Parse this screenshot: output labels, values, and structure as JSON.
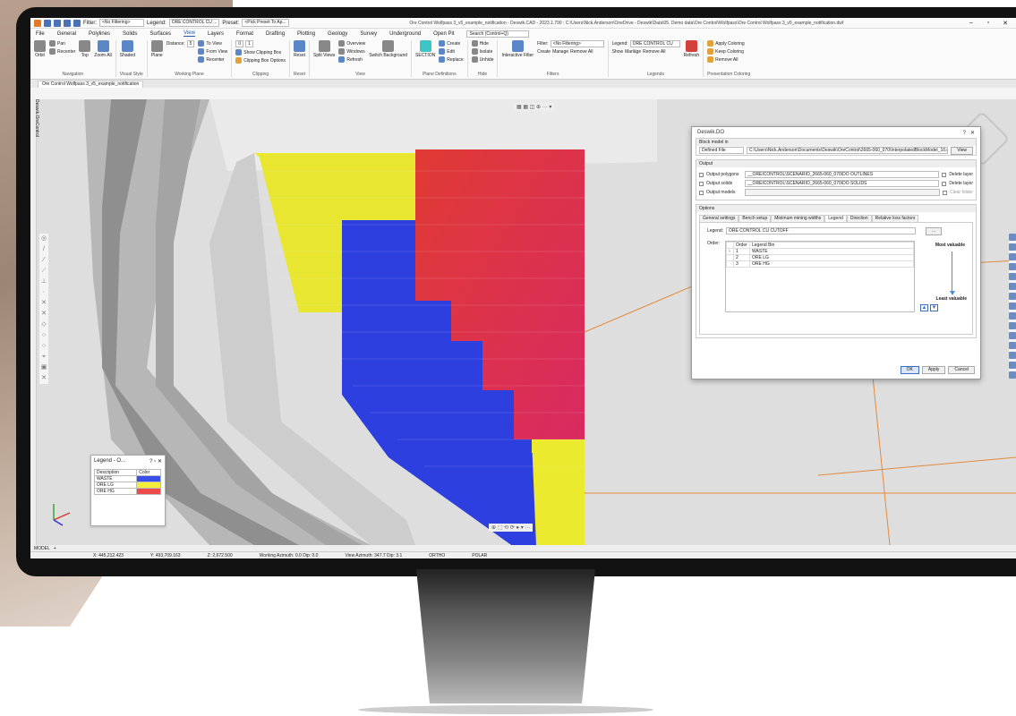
{
  "titlebar": {
    "filter_label": "Filter:",
    "filter_value": "<No Filtering>",
    "legend_label": "Legend:",
    "legend_value": "ORE CONTROL CU ...",
    "preset_label": "Preset:",
    "preset_value": "<Pick Preset To Ap...",
    "window_title": "Ore Control Wolfpass 3_v5_example_notification - Deswik.CAD - 2023.1.790 : C:\\Users\\Nick.Anderson\\OneDrive - Deswik\\Data\\05. Demo data\\Ore Control\\Wolfpass\\Ore Control Wolfpass 3_v5_example_notification.dwf"
  },
  "menu": {
    "items": [
      "File",
      "General",
      "Polylines",
      "Solids",
      "Surfaces",
      "View",
      "Layers",
      "Format",
      "Drafting",
      "Plotting",
      "Geology",
      "Survey",
      "Underground",
      "Open Pit"
    ],
    "active": "View",
    "search_placeholder": "Search (Control+Q)"
  },
  "ribbon": {
    "navigation": {
      "label": "Navigation",
      "orbit": "Orbit",
      "pan": "Pan",
      "recenter": "Recenter",
      "top": "Top",
      "zoom_all": "Zoom All"
    },
    "visual_style": {
      "label": "Visual Style",
      "shaded": "Shaded"
    },
    "working_plane": {
      "label": "Working Plane",
      "plane": "Plane",
      "distance_label": "Distance:",
      "distance_value": "5",
      "to_view": "To View",
      "from_view": "From View",
      "recenter": "Recenter"
    },
    "clipping": {
      "label": "Clipping",
      "show_box": "Show Clipping Box",
      "box_options": "Clipping Box Options",
      "v1": "0",
      "v2": "1"
    },
    "reset": {
      "label": "Reset",
      "reset": "Reset"
    },
    "view": {
      "label": "View",
      "split_views": "Split Views",
      "overview": "Overview",
      "windows": "Windows",
      "refresh": "Refresh",
      "switch_background": "Switch Background"
    },
    "plane_definitions": {
      "label": "Plane Definitions",
      "section": "SECTION",
      "create": "Create",
      "edit": "Edit",
      "replace": "Replace"
    },
    "hide": {
      "label": "Hide",
      "hide": "Hide",
      "isolate": "Isolate",
      "unhide": "Unhide"
    },
    "filters": {
      "label": "Filters",
      "interactive_filter": "Interactive Filter",
      "filter_label": "Filter:",
      "filter_value": "<No Filtering>",
      "create": "Create",
      "manage": "Manage",
      "remove_all": "Remove All"
    },
    "legends": {
      "label": "Legends",
      "legend_label": "Legend:",
      "legend_value": "ORE CONTROL CU ...",
      "show": "Show",
      "manage": "Manage",
      "remove_all": "Remove All",
      "refresh": "Refresh"
    },
    "presentation": {
      "label": "Presentation Coloring",
      "apply": "Apply Coloring",
      "keep": "Keep Coloring",
      "remove_all": "Remove All"
    }
  },
  "doc_tab": "Ore Control Wolfpass 3_v5_example_notification",
  "side_label": "Deswik.OreControl",
  "legend_panel": {
    "title": "Legend - O...",
    "col_description": "Description",
    "col_color": "Color",
    "rows": [
      {
        "description": "WASTE",
        "color": "#3a4ee8"
      },
      {
        "description": "ORE LG",
        "color": "#f2ec3a"
      },
      {
        "description": "ORE HG",
        "color": "#ef4a4a"
      }
    ]
  },
  "dialog": {
    "title": "Deswik.DO",
    "block_model_section": "Block model in",
    "block_model_type": "Defined File",
    "block_model_path": "C:\\Users\\Nick.Anderson\\Documents\\Deswik\\OreControl\\2665-060_070\\InterpolatedBlockModel_10.g",
    "view_button": "View",
    "output_section": "Output",
    "output_polygons_label": "Output polygons",
    "output_polygons_value": "__OREICONTROL\\SCENARIO_2665-060_070\\DO OUTLINES",
    "output_solids_label": "Output solids",
    "output_solids_value": "__OREICONTROL\\SCENARIO_2665-060_070\\DO SOLIDS",
    "output_models_label": "Output models",
    "delete_layer": "Delete layer",
    "clear_folder": "Clear folder",
    "options_section": "Options",
    "tabs": [
      "General settings",
      "Bench setup",
      "Minimum mining widths",
      "Legend",
      "Direction",
      "Relative loss factors"
    ],
    "active_tab": "Legend",
    "legend_label": "Legend:",
    "legend_value": "ORE CONTROL CU CUTOFF",
    "order_label": "Order:",
    "order_cols": [
      "Order",
      "Legend Bin"
    ],
    "order_rows": [
      {
        "order": "1",
        "bin": "WASTE"
      },
      {
        "order": "2",
        "bin": "ORE LG"
      },
      {
        "order": "3",
        "bin": "ORE HG"
      }
    ],
    "most_valuable": "Most valuable",
    "least_valuable": "Least valuable",
    "ok": "OK",
    "apply": "Apply",
    "cancel": "Cancel"
  },
  "model_tab": "MODEL",
  "status": {
    "x": "X: 445,212.423",
    "y": "Y: 493,709.163",
    "z": "Z: 2,672.500",
    "working_azimuth": "Working Azimuth: 0.0 Dip: 0.0",
    "view_azimuth": "View Azimuth: 347.7 Dip: 3.1",
    "ortho": "ORTHO",
    "polar": "POLAR"
  },
  "colors": {
    "waste": "#2e3fe0",
    "ore_lg": "#ecea2e",
    "ore_hg": "#e93b3b",
    "accent": "#1e5bb5"
  }
}
